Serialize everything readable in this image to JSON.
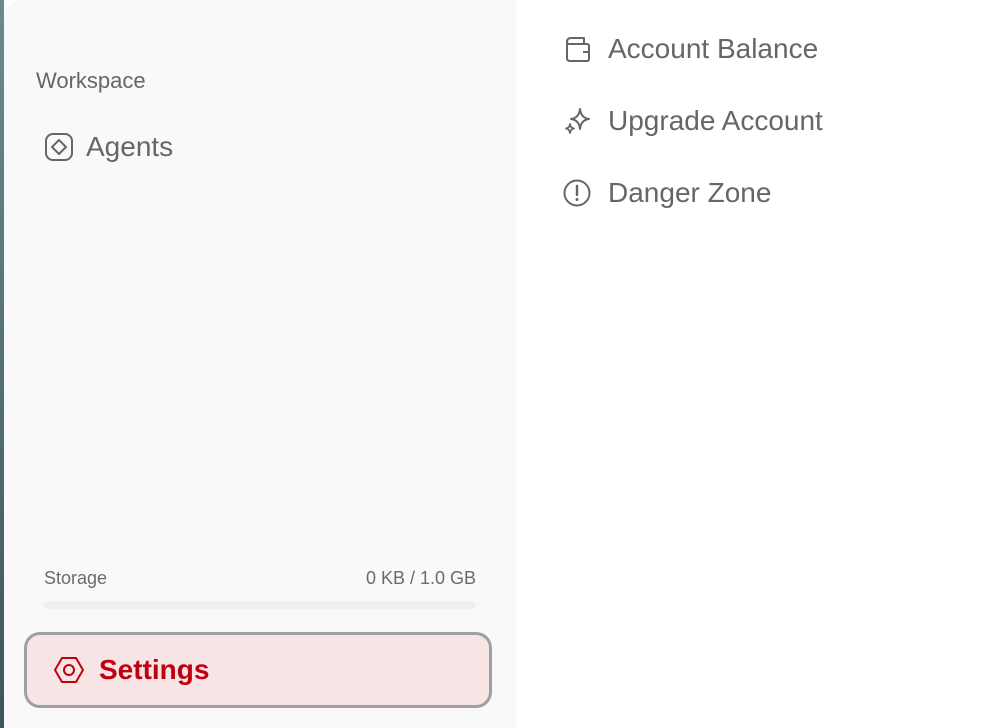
{
  "sidebar": {
    "section_label": "Workspace",
    "items": [
      {
        "label": "Agents",
        "icon": "agents-icon"
      }
    ],
    "storage": {
      "label": "Storage",
      "usage": "0 KB / 1.0 GB",
      "used_fraction": 0
    },
    "settings": {
      "label": "Settings",
      "icon": "settings-hexagon-icon",
      "active": true
    }
  },
  "menu": {
    "items": [
      {
        "label": "Account Balance",
        "icon": "wallet-icon"
      },
      {
        "label": "Upgrade Account",
        "icon": "sparkle-icon"
      },
      {
        "label": "Danger Zone",
        "icon": "alert-circle-icon"
      }
    ]
  },
  "colors": {
    "accent": "#c00010",
    "active_bg": "#f7e4e4",
    "sidebar_bg": "#f9f9f9",
    "text": "#666666"
  }
}
